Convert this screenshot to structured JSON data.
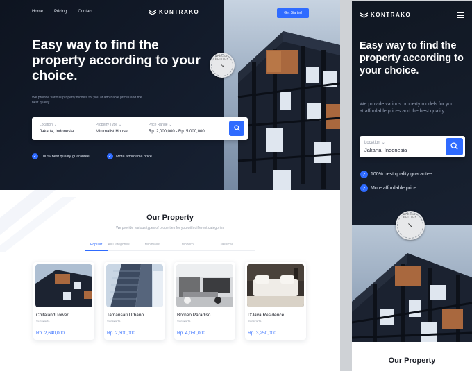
{
  "desktop": {
    "nav": [
      "Home",
      "Pricing",
      "Contact"
    ],
    "brand": "KONTRAKO",
    "cta_label": "Get Started",
    "headline": "Easy way to find the property according to your choice.",
    "subtext": "We provide various property models for you at affordable prices and the best quality",
    "badge_text": "SPECIAL EDITION",
    "search": {
      "location_label": "Location",
      "location_value": "Jakarta, Indonesia",
      "type_label": "Property Type",
      "type_value": "Minimalist House",
      "price_label": "Price Range",
      "price_value": "Rp. 2,000,000 - Rp. 5,000,000"
    },
    "checks": [
      "100% best quality guarantee",
      "More affordable price"
    ],
    "property": {
      "title": "Our Property",
      "subtitle": "We provide various types of properties for you with different categories",
      "tabs": [
        "Popular",
        "All Categories",
        "Minimalist",
        "Modern",
        "Classical"
      ],
      "cards": [
        {
          "name": "Chitaland Tower",
          "city": "Surakarta",
          "price": "Rp. 2,640,000"
        },
        {
          "name": "Tamansari Urbano",
          "city": "Surakarta",
          "price": "Rp. 2,300,000"
        },
        {
          "name": "Borneo Paradiso",
          "city": "Surakarta",
          "price": "Rp. 4,050,000"
        },
        {
          "name": "D'Java Residence",
          "city": "Surakarta",
          "price": "Rp. 3,250,000"
        }
      ]
    }
  },
  "mobile": {
    "brand": "KONTRAKO",
    "headline": "Easy way to find the property according to your choice.",
    "subtext": "We provide various property models for you at affordable prices and the best quality",
    "location_label": "Location",
    "location_value": "Jakarta, Indonesia",
    "checks": [
      "100% best quality guarantee",
      "More affordable price"
    ],
    "badge_text": "SPECIAL EDITION",
    "property_title": "Our Property"
  },
  "colors": {
    "accent": "#2f6bff",
    "hero_bg": "#121a28",
    "price": "#2f6bff"
  },
  "icons": [
    "logo-icon",
    "search-icon",
    "check-icon",
    "chevron-down-icon",
    "menu-icon",
    "arrow-icon"
  ]
}
